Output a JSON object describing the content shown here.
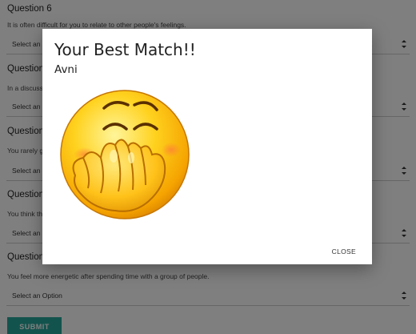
{
  "form": {
    "questions": [
      {
        "title": "Question 6",
        "text": "It is often difficult for you to relate to other people's feelings.",
        "select": "Select an Option"
      },
      {
        "title": "Question",
        "text": "In a discuss",
        "select": "Select an"
      },
      {
        "title": "Question",
        "text": "You rarely g",
        "select": "Select an"
      },
      {
        "title": "Question",
        "text": "You think th",
        "select": "Select an"
      },
      {
        "title": "Question",
        "text": "You feel more energetic after spending time with a group of people.",
        "select": "Select an Option"
      }
    ],
    "submit_label": "SUBMIT"
  },
  "modal": {
    "title": "Your Best Match!!",
    "name": "Avni",
    "image_icon": "shy-laughing-emoji-icon",
    "close_label": "CLOSE"
  },
  "colors": {
    "accent": "#26a69a",
    "overlay": "#000000"
  }
}
